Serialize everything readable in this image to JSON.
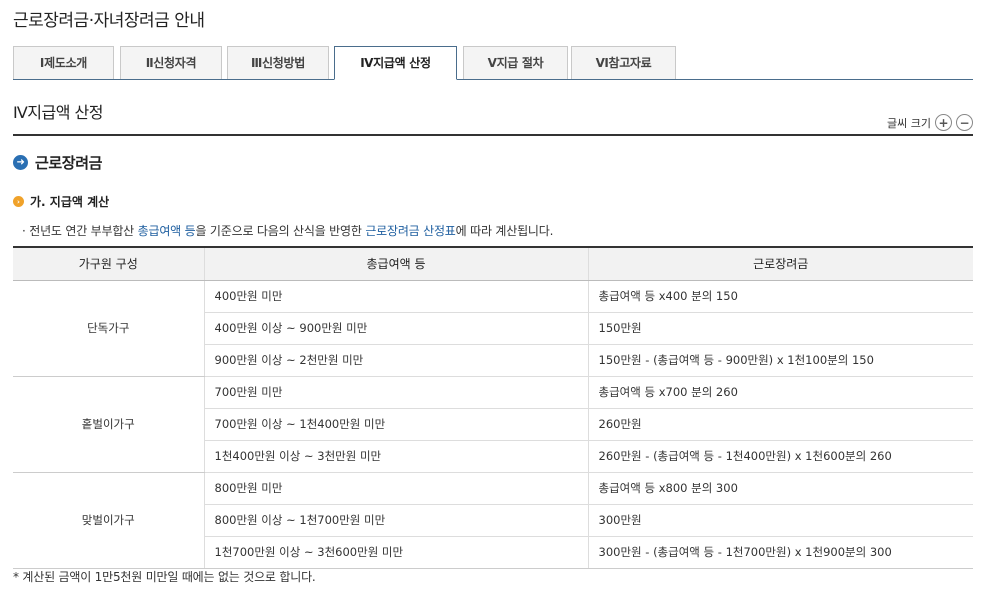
{
  "page": {
    "title": "근로장려금·자녀장려금 안내"
  },
  "tabs": [
    {
      "label": "Ⅰ제도소개"
    },
    {
      "label": "Ⅱ신청자격"
    },
    {
      "label": "Ⅲ신청방법"
    },
    {
      "label": "Ⅳ지급액 산정"
    },
    {
      "label": "Ⅴ지급 절차"
    },
    {
      "label": "Ⅵ참고자료"
    }
  ],
  "section": {
    "title": "Ⅳ지급액 산정",
    "font_size_label": "글씨 크기",
    "increase": "+",
    "decrease": "−"
  },
  "subsection": {
    "title": "근로장려금"
  },
  "subheading": {
    "title": "가. 지급액 계산"
  },
  "description": {
    "prefix": "· 전년도 연간 부부합산 ",
    "link1": "총급여액 등",
    "middle": "을 기준으로 다음의 산식을 반영한 ",
    "link2": "근로장려금 산정표",
    "suffix": "에 따라 계산됩니다."
  },
  "table": {
    "headers": [
      "가구원 구성",
      "총급여액 등",
      "근로장려금"
    ],
    "groups": [
      {
        "name": "단독가구",
        "rows": [
          {
            "income": "400만원 미만",
            "amount": "총급여액 등 x400 분의 150"
          },
          {
            "income": "400만원 이상 ~ 900만원 미만",
            "amount": "150만원"
          },
          {
            "income": "900만원 이상 ~ 2천만원 미만",
            "amount": "150만원 - (총급여액 등 - 900만원) x 1천100분의 150"
          }
        ]
      },
      {
        "name": "홑벌이가구",
        "rows": [
          {
            "income": "700만원 미만",
            "amount": "총급여액 등 x700 분의 260"
          },
          {
            "income": "700만원 이상 ~ 1천400만원 미만",
            "amount": "260만원"
          },
          {
            "income": "1천400만원 이상 ~ 3천만원 미만",
            "amount": "260만원 - (총급여액 등 - 1천400만원) x 1천600분의 260"
          }
        ]
      },
      {
        "name": "맞벌이가구",
        "rows": [
          {
            "income": "800만원 미만",
            "amount": "총급여액 등 x800 분의 300"
          },
          {
            "income": "800만원 이상 ~ 1천700만원 미만",
            "amount": "300만원"
          },
          {
            "income": "1천700만원 이상 ~ 3천600만원 미만",
            "amount": "300만원 - (총급여액 등 - 1천700만원) x 1천900분의 300"
          }
        ]
      }
    ]
  },
  "footnote": "* 계산된 금액이 1만5천원 미만일 때에는 없는 것으로 합니다.",
  "colors": {
    "accent": "#2a6fb3",
    "bullet": "#f0a22a",
    "link": "#1f5fa0",
    "tab_border": "#4a6d8c"
  },
  "icons": {
    "section_arrow": "arrow-right-circle-icon",
    "subheading_bullet": "orange-bullet-icon"
  }
}
